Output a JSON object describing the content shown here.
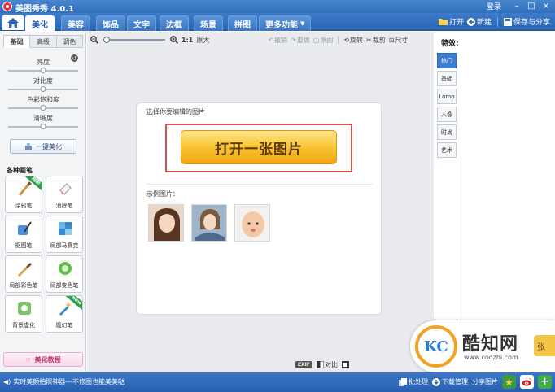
{
  "window": {
    "title": "美图秀秀 4.0.1",
    "login": "登录",
    "controls": [
      "–",
      "□",
      "×"
    ]
  },
  "tabs": [
    {
      "label": "美化",
      "active": true
    },
    {
      "label": "美容",
      "active": false
    },
    {
      "label": "饰品",
      "active": false
    },
    {
      "label": "文字",
      "active": false
    },
    {
      "label": "边框",
      "active": false
    },
    {
      "label": "场景",
      "active": false
    },
    {
      "label": "拼图",
      "active": false
    },
    {
      "label": "更多功能",
      "active": false
    }
  ],
  "top_actions": {
    "open": "打开",
    "new": "新建",
    "save_share": "保存与分享"
  },
  "left": {
    "subtabs": [
      "基础",
      "高级",
      "调色"
    ],
    "sliders": [
      {
        "label": "亮度",
        "value": 0.5
      },
      {
        "label": "对比度",
        "value": 0.5
      },
      {
        "label": "色彩饱和度",
        "value": 0.5
      },
      {
        "label": "清晰度",
        "value": 0.5
      }
    ],
    "one_click": "一键美化",
    "pens_title": "各种画笔",
    "pens": [
      {
        "label": "涂鸦笔",
        "badge": "超新"
      },
      {
        "label": "消除笔",
        "badge": ""
      },
      {
        "label": "抠图笔",
        "badge": ""
      },
      {
        "label": "局部马赛克",
        "badge": ""
      },
      {
        "label": "局部彩色笔",
        "badge": ""
      },
      {
        "label": "局部变色笔",
        "badge": ""
      },
      {
        "label": "背景虚化",
        "badge": ""
      },
      {
        "label": "魔幻笔",
        "badge": "new"
      }
    ],
    "tutorial": "美化教程"
  },
  "toolbar": {
    "zoom_value": 0.05,
    "ratio": "1:1",
    "original_size": "原大",
    "undo": "撤销",
    "redo": "重做",
    "original_image": "原图",
    "rotate": "旋转",
    "crop": "裁剪",
    "resize": "尺寸"
  },
  "canvas": {
    "choose_text": "选择你要编辑的图片",
    "open_button": "打开一张图片",
    "examples_label": "示例图片：",
    "bottom_exif": "EXIF",
    "bottom_compare": "对比"
  },
  "right": {
    "effects_title": "特效:",
    "categories": [
      {
        "label": "热门",
        "active": true
      },
      {
        "label": "基础",
        "active": false
      },
      {
        "label": "Lomo",
        "active": false
      },
      {
        "label": "人像",
        "active": false
      },
      {
        "label": "时尚",
        "active": false
      },
      {
        "label": "艺术",
        "active": false
      }
    ]
  },
  "status": {
    "tip": "实时美颜拍照神器---不修图也能美美哒",
    "batch": "批处理",
    "download_mgr": "下载管理",
    "share_pic": "分享图片"
  },
  "watermark": {
    "circle_text": "KC",
    "brand": "酷知网",
    "url": "www.coozhi.com",
    "peek": "张"
  },
  "colors": {
    "accent_blue": "#3c7fd0",
    "open_button_yellow": "#f7c02a",
    "highlight_red": "#d8534f"
  }
}
